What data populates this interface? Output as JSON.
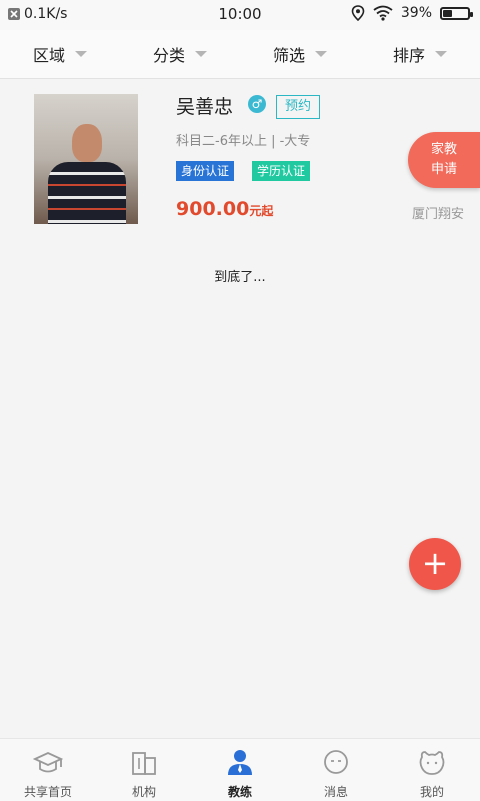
{
  "status": {
    "net_speed": "0.1K/s",
    "time": "10:00",
    "battery": "39%",
    "battery_level": 0.39
  },
  "filters": [
    "区域",
    "分类",
    "筛选",
    "排序"
  ],
  "teacher": {
    "name": "吴善忠",
    "gender_symbol": "♂",
    "book_label": "预约",
    "subject_line": "科目二-6年以上  |  -大专",
    "badges": [
      "身份认证",
      "学历认证"
    ],
    "price": "900.00",
    "price_unit": "元起",
    "location": "厦门翔安"
  },
  "apply_button": {
    "line1": "家教",
    "line2": "申请"
  },
  "end_text": "到底了...",
  "fab_symbol": "+",
  "tabs": [
    {
      "label": "共享首页",
      "icon": "graduation-cap-icon"
    },
    {
      "label": "机构",
      "icon": "building-icon"
    },
    {
      "label": "教练",
      "icon": "coach-user-icon",
      "active": true
    },
    {
      "label": "消息",
      "icon": "message-bubble-icon"
    },
    {
      "label": "我的",
      "icon": "profile-face-icon"
    }
  ]
}
